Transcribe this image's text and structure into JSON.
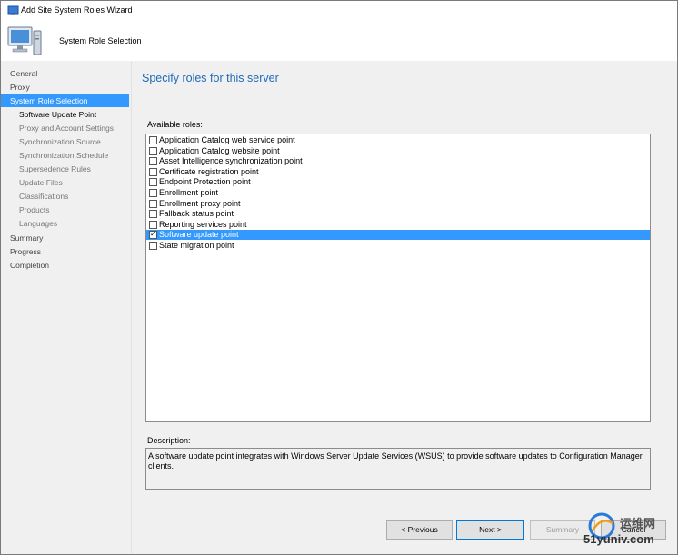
{
  "window": {
    "title": "Add Site System Roles Wizard"
  },
  "banner": {
    "title": "System Role Selection"
  },
  "nav": {
    "items": [
      {
        "label": "General",
        "level": 0,
        "state": "done"
      },
      {
        "label": "Proxy",
        "level": 0,
        "state": "done"
      },
      {
        "label": "System Role Selection",
        "level": 0,
        "state": "active"
      },
      {
        "label": "Software Update Point",
        "level": 1,
        "state": "current"
      },
      {
        "label": "Proxy and Account Settings",
        "level": 1,
        "state": "pending"
      },
      {
        "label": "Synchronization Source",
        "level": 1,
        "state": "pending"
      },
      {
        "label": "Synchronization Schedule",
        "level": 1,
        "state": "pending"
      },
      {
        "label": "Supersedence Rules",
        "level": 1,
        "state": "pending"
      },
      {
        "label": "Update Files",
        "level": 1,
        "state": "pending"
      },
      {
        "label": "Classifications",
        "level": 1,
        "state": "pending"
      },
      {
        "label": "Products",
        "level": 1,
        "state": "pending"
      },
      {
        "label": "Languages",
        "level": 1,
        "state": "pending"
      },
      {
        "label": "Summary",
        "level": 0,
        "state": "pending"
      },
      {
        "label": "Progress",
        "level": 0,
        "state": "pending"
      },
      {
        "label": "Completion",
        "level": 0,
        "state": "pending"
      }
    ]
  },
  "main": {
    "heading": "Specify roles for this server",
    "available_label": "Available roles:",
    "roles": [
      {
        "label": "Application Catalog web service point",
        "checked": false,
        "selected": false
      },
      {
        "label": "Application Catalog website point",
        "checked": false,
        "selected": false
      },
      {
        "label": "Asset Intelligence synchronization point",
        "checked": false,
        "selected": false
      },
      {
        "label": "Certificate registration point",
        "checked": false,
        "selected": false
      },
      {
        "label": "Endpoint Protection point",
        "checked": false,
        "selected": false
      },
      {
        "label": "Enrollment point",
        "checked": false,
        "selected": false
      },
      {
        "label": "Enrollment proxy point",
        "checked": false,
        "selected": false
      },
      {
        "label": "Fallback status point",
        "checked": false,
        "selected": false
      },
      {
        "label": "Reporting services point",
        "checked": false,
        "selected": false
      },
      {
        "label": "Software update point",
        "checked": true,
        "selected": true
      },
      {
        "label": "State migration point",
        "checked": false,
        "selected": false
      }
    ],
    "description_label": "Description:",
    "description_text": "A software update point integrates with Windows Server Update Services (WSUS) to provide software updates to Configuration Manager clients."
  },
  "buttons": {
    "previous": "< Previous",
    "next": "Next >",
    "summary": "Summary",
    "cancel": "Cancel"
  },
  "watermark": {
    "line1": "运维网",
    "line2": "51yuniv.com"
  },
  "colors": {
    "accent": "#3399ff",
    "heading": "#1e6ab8",
    "background": "#f0f0f0"
  }
}
